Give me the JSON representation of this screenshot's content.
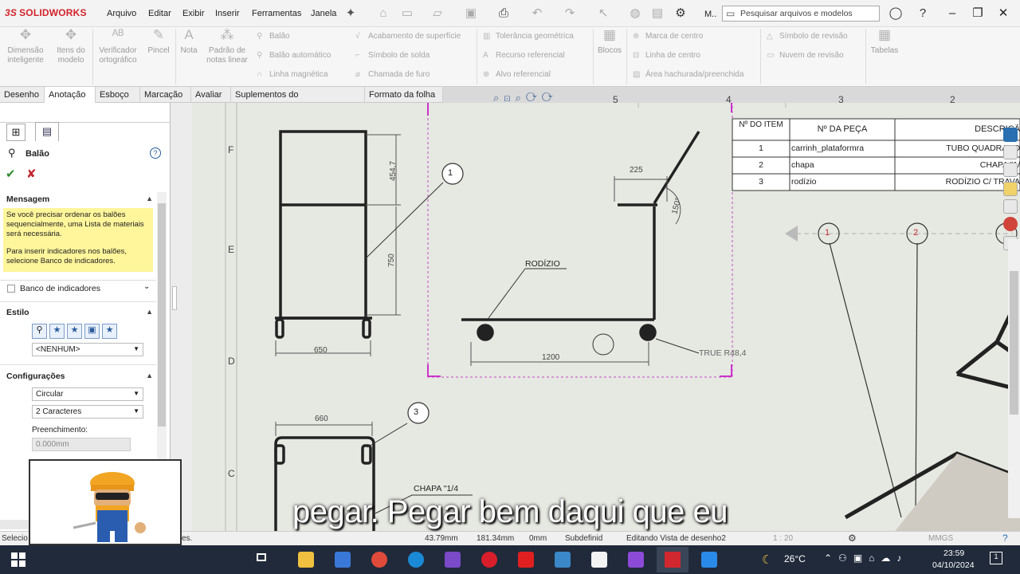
{
  "app": {
    "brand": "SOLIDWORKS",
    "brand_prefix": "3S"
  },
  "menu": [
    "Arquivo",
    "Editar",
    "Exibir",
    "Inserir",
    "Ferramentas",
    "Janela"
  ],
  "titlebar": {
    "user_label": "M..",
    "search_placeholder": "Pesquisar arquivos e modelos"
  },
  "ribbon": {
    "big": [
      {
        "label": "Dimensão inteligente"
      },
      {
        "label": "Itens do modelo"
      },
      {
        "label": "Verificador ortográfico"
      },
      {
        "label": "Pincel"
      },
      {
        "label": "Nota"
      },
      {
        "label": "Padrão de notas linear"
      },
      {
        "label": "Blocos"
      },
      {
        "label": "Tabelas"
      }
    ],
    "col1": [
      "Balão",
      "Balão automático",
      "Linha magnética"
    ],
    "col2": [
      "Acabamento de superfície",
      "Símbolo de solda",
      "Chamada de furo"
    ],
    "col3": [
      "Tolerância geométrica",
      "Recurso referencial",
      "Alvo referencial"
    ],
    "col4": [
      "Marca de centro",
      "Linha de centro",
      "Área hachurada/preenchida"
    ],
    "col5": [
      "Símbolo de revisão",
      "Nuvem de revisão"
    ]
  },
  "tabs": [
    "Desenho",
    "Anotação",
    "Esboço",
    "Marcação",
    "Avaliar",
    "Suplementos do SOLIDWORKS",
    "Formato da folha"
  ],
  "active_tab": "Anotação",
  "panel": {
    "title": "Balão",
    "message_title": "Mensagem",
    "message_1": "Se você precisar ordenar os balões sequencialmente, uma Lista de materiais será necessária.",
    "message_2": "Para inserir indicadores nos balões, selecione Banco de indicadores.",
    "indicator_bank": "Banco de indicadores",
    "style_title": "Estilo",
    "style_value": "<NENHUM>",
    "config_title": "Configurações",
    "shape_value": "Circular",
    "chars_value": "2 Caracteres",
    "fill_label": "Preenchimento:",
    "fill_value": "0.000mm"
  },
  "sheet": {
    "zone_letters": [
      "F",
      "E",
      "D",
      "C"
    ],
    "top_numbers": [
      "5",
      "4",
      "3",
      "2"
    ],
    "dims": {
      "d1": "454,7",
      "d2": "750",
      "d3": "650",
      "d4": "225",
      "d5": "150°",
      "d6": "1200",
      "d7": "660"
    },
    "labels": {
      "rodizio": "RODÍZIO",
      "true": "TRUE R48,4",
      "chapa": "CHAPA \"1/4"
    },
    "balloons": [
      "1",
      "2",
      "3"
    ]
  },
  "bom": {
    "headers": [
      "Nº DO ITEM",
      "Nº DA PEÇA",
      "DESCRIÇÃ"
    ],
    "rows": [
      [
        "1",
        "carrinh_plataformra",
        "TUBO QUADRADO"
      ],
      [
        "2",
        "chapa",
        "CHAPA \"1/"
      ],
      [
        "3",
        "rodízio",
        "RODÍZIO C/ TRAVA"
      ]
    ]
  },
  "status": {
    "left": "Selecio",
    "left2": "es.",
    "x": "43.79mm",
    "y": "181.34mm",
    "z": "0mm",
    "state": "Subdefinid",
    "editing": "Editando Vista de desenho2",
    "scale": "1 : 20",
    "units": "MMGS"
  },
  "caption": "pegar. Pegar bem daqui que eu",
  "taskbar": {
    "temp": "26°C",
    "time": "23:59",
    "date": "04/10/2024",
    "notif": "1"
  }
}
